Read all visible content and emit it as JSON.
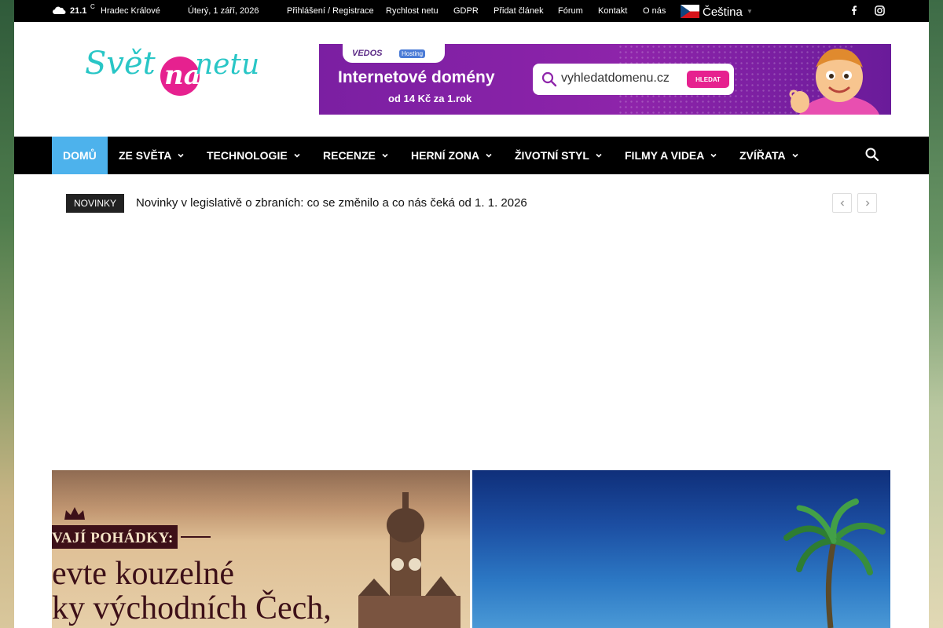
{
  "topbar": {
    "temperature": "21.1",
    "temp_unit": "C",
    "city": "Hradec Králové",
    "date": "Úterý, 1 září, 2026",
    "links": [
      "Přihlášení / Registrace",
      "Rychlost netu",
      "GDPR",
      "Přidat článek",
      "Fórum",
      "Kontakt",
      "O nás"
    ],
    "language": "Čeština",
    "icons": [
      "cloud-icon",
      "czech-flag-icon",
      "facebook-icon",
      "instagram-icon"
    ]
  },
  "logo": {
    "part1": "Svět",
    "part2": "na",
    "part3": "netu"
  },
  "banner": {
    "brand": "VEDOS",
    "brand_badge": "Hosting",
    "title": "Internetové domény",
    "subtitle": "od 14 Kč za 1.rok",
    "domain": "vyhledatdomenu.cz",
    "button": "HLEDAT"
  },
  "menu": {
    "items": [
      {
        "label": "DOMŮ",
        "active": true,
        "has_dropdown": false
      },
      {
        "label": "ZE SVĚTA",
        "active": false,
        "has_dropdown": true
      },
      {
        "label": "TECHNOLOGIE",
        "active": false,
        "has_dropdown": true
      },
      {
        "label": "RECENZE",
        "active": false,
        "has_dropdown": true
      },
      {
        "label": "HERNÍ ZONA",
        "active": false,
        "has_dropdown": true
      },
      {
        "label": "ŽIVOTNÍ STYL",
        "active": false,
        "has_dropdown": true
      },
      {
        "label": "FILMY A VIDEA",
        "active": false,
        "has_dropdown": true
      },
      {
        "label": "ZVÍŘATA",
        "active": false,
        "has_dropdown": true
      }
    ],
    "accent_color": "#4db2ec"
  },
  "ticker": {
    "label": "NOVINKY",
    "headline": "Novinky v legislativě o zbraních: co se změnilo a co nás čeká od 1. 1. 2026"
  },
  "cards": {
    "left": {
      "ribbon": "VAJÍ POHÁDKY:",
      "line1": "evte kouzelné",
      "line2": "ky východních Čech,"
    }
  },
  "colors": {
    "logo_teal": "#29c6c6",
    "logo_pink": "#e6218f",
    "banner_purple": "#8e24aa"
  }
}
